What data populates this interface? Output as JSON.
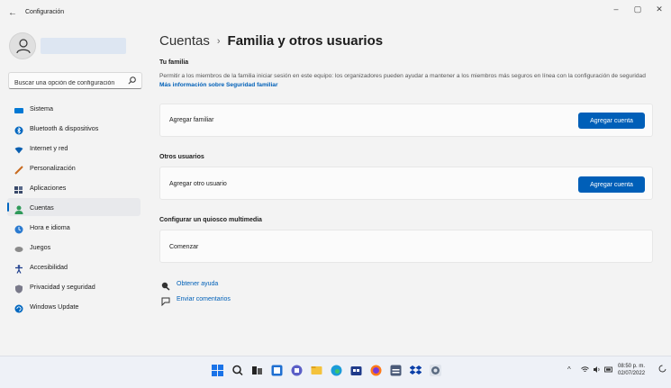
{
  "window": {
    "app_title": "Configuración",
    "back_glyph": "←",
    "controls": {
      "minimize": "–",
      "maximize": "▢",
      "close": "✕"
    }
  },
  "search": {
    "placeholder": "Buscar una opción de configuración"
  },
  "sidebar": {
    "items": [
      {
        "label": "Sistema",
        "icon": "system-icon",
        "color": "#0078d4"
      },
      {
        "label": "Bluetooth & dispositivos",
        "icon": "bluetooth-icon",
        "color": "#0067c0"
      },
      {
        "label": "Internet y red",
        "icon": "wifi-icon",
        "color": "#0a5fb0"
      },
      {
        "label": "Personalización",
        "icon": "pen-icon",
        "color": "#c86a1f"
      },
      {
        "label": "Aplicaciones",
        "icon": "apps-icon",
        "color": "#3a4a6a"
      },
      {
        "label": "Cuentas",
        "icon": "accounts-icon",
        "color": "#2f9a5a",
        "active": true
      },
      {
        "label": "Hora e idioma",
        "icon": "clock-globe-icon",
        "color": "#2a7ad0"
      },
      {
        "label": "Juegos",
        "icon": "gamepad-icon",
        "color": "#707070"
      },
      {
        "label": "Accesibilidad",
        "icon": "accessibility-icon",
        "color": "#1a3a8a"
      },
      {
        "label": "Privacidad y seguridad",
        "icon": "shield-icon",
        "color": "#6a6a7a"
      },
      {
        "label": "Windows Update",
        "icon": "update-icon",
        "color": "#0067c0"
      }
    ]
  },
  "header": {
    "breadcrumb_parent": "Cuentas",
    "breadcrumb_sep": "›",
    "title": "Familia y otros usuarios"
  },
  "family": {
    "title": "Tu familia",
    "description": "Permitir a los miembros de la familia iniciar sesión en este equipo: los organizadores pueden ayudar a mantener a los miembros más seguros en línea con la configuración de seguridad",
    "link": "Más información sobre Seguridad familiar",
    "card_label": "Agregar familiar",
    "button": "Agregar cuenta"
  },
  "others": {
    "title": "Otros usuarios",
    "card_label": "Agregar otro usuario",
    "button": "Agregar cuenta"
  },
  "kiosk": {
    "title": "Configurar un quiosco multimedia",
    "card_label": "Comenzar"
  },
  "help": {
    "get_help": "Obtener ayuda",
    "feedback": "Enviar comentarios"
  },
  "taskbar": {
    "time": "08:50 p. m.",
    "date": "02/07/2022",
    "tray_up": "^",
    "colors": {
      "start": "#1a73e8",
      "accent": "#005fb8"
    }
  }
}
